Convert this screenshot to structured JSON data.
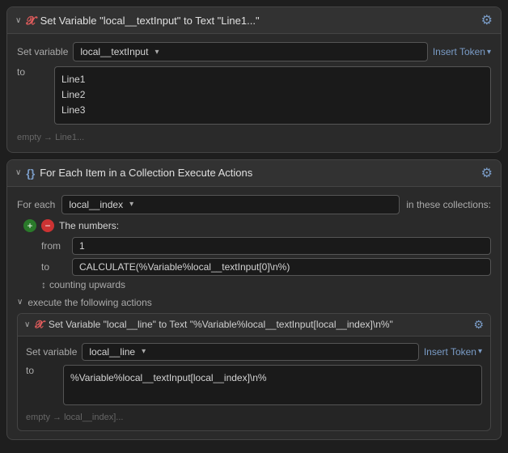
{
  "block1": {
    "title": "Set Variable \"local__textInput\" to Text \"Line1...\"",
    "chevron": "∨",
    "x_symbol": "𝓧",
    "set_variable_label": "Set variable",
    "variable_name": "local__textInput",
    "to_label": "to",
    "multiline_value": "Line1\nLine2\nLine3",
    "footer": "empty → Line1...",
    "gear_symbol": "⚙",
    "insert_token": "Insert Token"
  },
  "block2": {
    "title": "For Each Item in a Collection Execute Actions",
    "chevron": "∨",
    "x_symbol": "{}",
    "gear_symbol": "⚙",
    "for_each_label": "For each",
    "variable_name": "local__index",
    "in_these_label": "in these collections:",
    "numbers_label": "The numbers:",
    "from_label": "from",
    "from_value": "1",
    "to_label": "to",
    "to_value": "CALCULATE(%Variable%local__textInput[0]\\n%)",
    "counting_label": "counting upwards",
    "execute_label": "execute the following actions",
    "inner_block": {
      "title": "Set Variable \"local__line\" to Text \"%Variable%local__textInput[local__index]\\n%\"",
      "x_symbol": "𝓧",
      "chevron": "∨",
      "gear_symbol": "⚙",
      "set_variable_label": "Set variable",
      "variable_name": "local__line",
      "to_label": "to",
      "to_value": "%Variable%local__textInput[local__index]\\n%",
      "footer": "empty → local__index]...",
      "insert_token": "Insert Token"
    }
  }
}
